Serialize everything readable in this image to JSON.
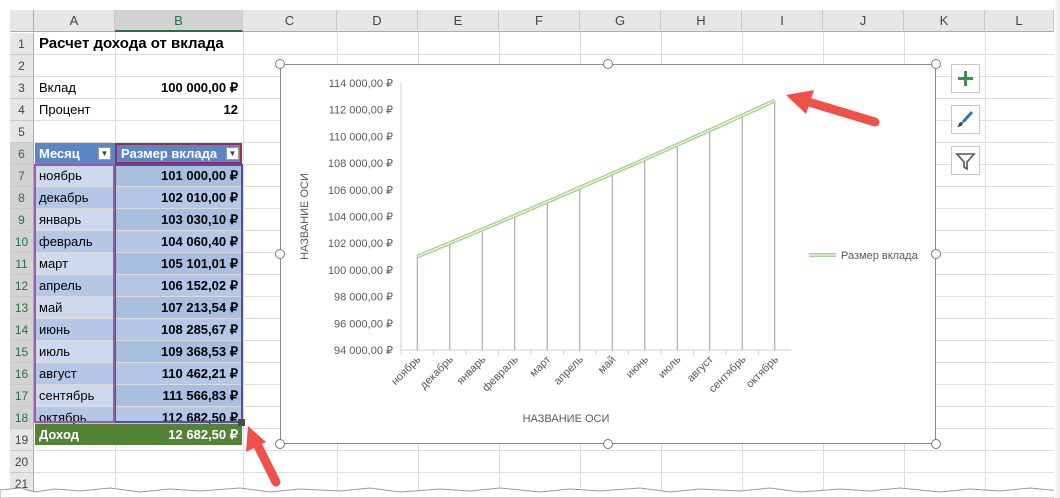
{
  "columns": [
    "A",
    "B",
    "C",
    "D",
    "E",
    "F",
    "G",
    "H",
    "I",
    "J",
    "K",
    "L"
  ],
  "rows": [
    "1",
    "2",
    "3",
    "4",
    "5",
    "6",
    "7",
    "8",
    "9",
    "10",
    "11",
    "12",
    "13",
    "14",
    "15",
    "16",
    "17",
    "18",
    "19",
    "20",
    "21"
  ],
  "title": "Расчет дохода от вклада",
  "inputs": {
    "deposit_label": "Вклад",
    "deposit_value": "100 000,00 ₽",
    "percent_label": "Процент",
    "percent_value": "12"
  },
  "table": {
    "header_month": "Месяц",
    "header_size": "Размер вклада",
    "filter_glyph": "▼",
    "rows": [
      {
        "month": "ноябрь",
        "value": "101 000,00 ₽"
      },
      {
        "month": "декабрь",
        "value": "102 010,00 ₽"
      },
      {
        "month": "январь",
        "value": "103 030,10 ₽"
      },
      {
        "month": "февраль",
        "value": "104 060,40 ₽"
      },
      {
        "month": "март",
        "value": "105 101,01 ₽"
      },
      {
        "month": "апрель",
        "value": "106 152,02 ₽"
      },
      {
        "month": "май",
        "value": "107 213,54 ₽"
      },
      {
        "month": "июнь",
        "value": "108 285,67 ₽"
      },
      {
        "month": "июль",
        "value": "109 368,53 ₽"
      },
      {
        "month": "август",
        "value": "110 462,21 ₽"
      },
      {
        "month": "сентябрь",
        "value": "111 566,83 ₽"
      },
      {
        "month": "октябрь",
        "value": "112 682,50 ₽"
      }
    ],
    "total_label": "Доход",
    "total_value": "12 682,50 ₽"
  },
  "chart_side_buttons": {
    "add_element_icon": "plus-icon",
    "style_icon": "brush-icon",
    "filter_icon": "funnel-icon"
  },
  "colors": {
    "accent_excel": "#217346",
    "line_color": "#70ad47",
    "arrow_color": "#f0504a"
  },
  "chart_data": {
    "type": "line",
    "categories": [
      "ноябрь",
      "декабрь",
      "январь",
      "февраль",
      "март",
      "апрель",
      "май",
      "июнь",
      "июль",
      "август",
      "сентябрь",
      "октябрь"
    ],
    "series": [
      {
        "name": "Размер вклада",
        "values": [
          101000.0,
          102010.0,
          103030.1,
          104060.4,
          105101.01,
          106152.02,
          107213.54,
          108285.67,
          109368.53,
          110462.21,
          111566.83,
          112682.5
        ]
      }
    ],
    "xlabel": "НАЗВАНИЕ ОСИ",
    "ylabel": "НАЗВАНИЕ ОСИ",
    "ylim": [
      94000,
      114000
    ],
    "y_ticks": [
      "94 000,00 ₽",
      "96 000,00 ₽",
      "98 000,00 ₽",
      "100 000,00 ₽",
      "102 000,00 ₽",
      "104 000,00 ₽",
      "106 000,00 ₽",
      "108 000,00 ₽",
      "110 000,00 ₽",
      "112 000,00 ₽",
      "114 000,00 ₽"
    ],
    "drop_lines": true,
    "grid": false,
    "legend_position": "right"
  }
}
